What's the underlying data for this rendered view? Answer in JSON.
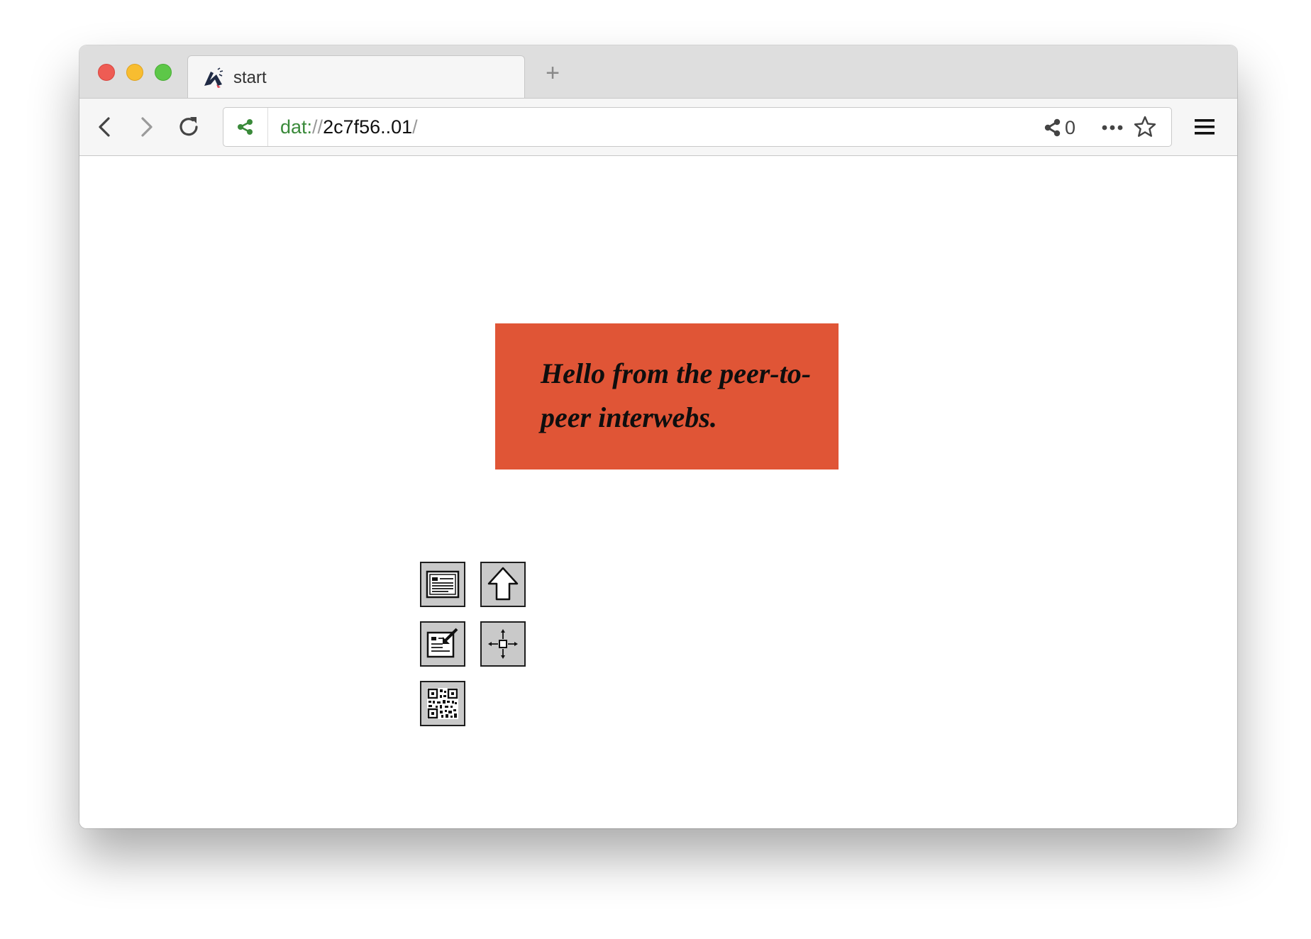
{
  "tab": {
    "title": "start"
  },
  "new_tab_label": "+",
  "urlbar": {
    "scheme": "dat:",
    "separator": "//",
    "host": "2c7f56..01",
    "trailing": "/"
  },
  "peers": {
    "count": "0"
  },
  "content": {
    "banner_text": "Hello from the peer-to-peer interwebs.",
    "banner_color": "#e05536"
  },
  "icons": {
    "back": "back-arrow-icon",
    "forward": "forward-arrow-icon",
    "reload": "reload-icon",
    "site_identity": "share-network-icon",
    "peers": "share-network-icon",
    "page_actions": "ellipsis-icon",
    "bookmark": "star-icon",
    "menu": "hamburger-menu-icon"
  }
}
